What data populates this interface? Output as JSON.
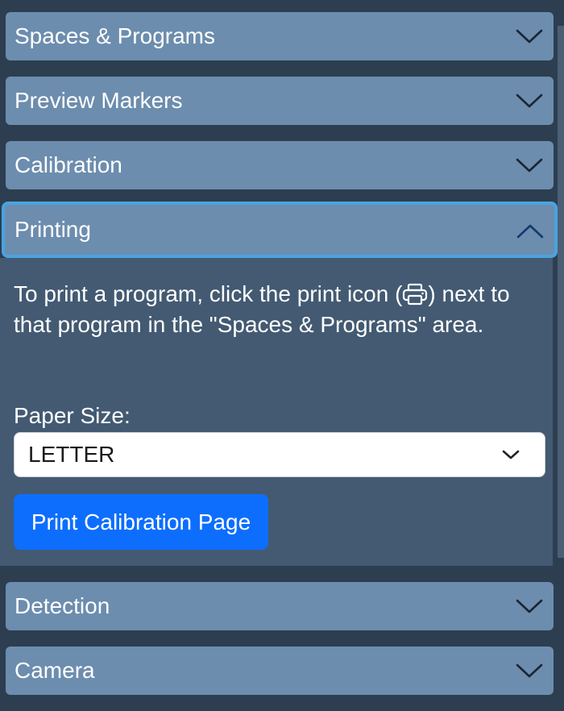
{
  "sections": {
    "spaces": {
      "label": "Spaces & Programs"
    },
    "preview": {
      "label": "Preview Markers"
    },
    "calibration": {
      "label": "Calibration"
    },
    "printing": {
      "label": "Printing",
      "description_part1": "To print a program, click the print icon (",
      "description_part2": ") next to that program in the \"Spaces & Programs\" area.",
      "paper_size_label": "Paper Size:",
      "paper_size_value": "LETTER",
      "print_calibration_label": "Print Calibration Page"
    },
    "detection": {
      "label": "Detection"
    },
    "camera": {
      "label": "Camera"
    }
  },
  "colors": {
    "page_bg": "#2c3e50",
    "header_bg": "#6c8dae",
    "body_bg": "#435a72",
    "focus_ring": "#4aa3e0",
    "primary": "#0d6efd"
  },
  "icons": {
    "collapsed": "chevron-down-icon",
    "expanded": "chevron-up-icon",
    "print": "printer-icon"
  }
}
